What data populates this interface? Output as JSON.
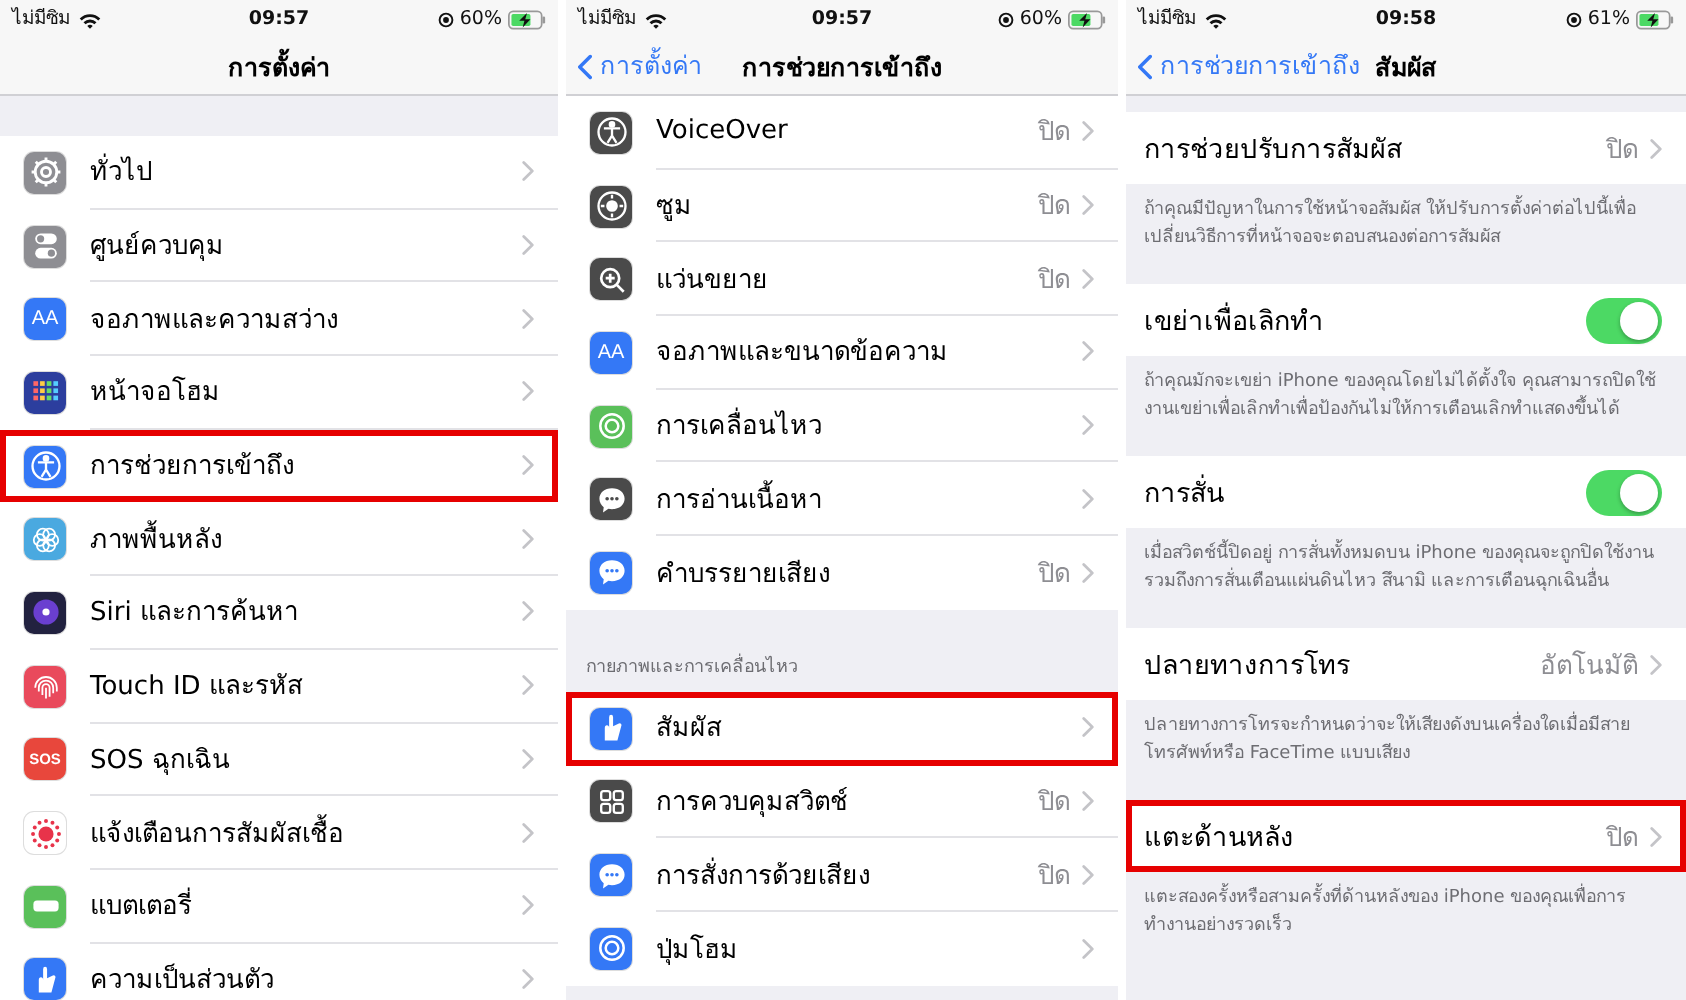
{
  "panels": [
    {
      "kind": "root",
      "status_bar": {
        "carrier": "ไม่มีซิม",
        "time": "09:57",
        "battery": "60%"
      },
      "nav": {
        "title": "การตั้งค่า"
      },
      "groups": [
        {
          "rows": [
            {
              "kind": "link",
              "label": "ทั่วไป",
              "icon": {
                "kind": "gear",
                "color": "#8e8e93"
              },
              "highlighted": false
            },
            {
              "kind": "link",
              "label": "ศูนย์ควบคุม",
              "icon": {
                "kind": "toggles",
                "color": "#8e8e93"
              },
              "highlighted": false
            },
            {
              "kind": "link",
              "label": "จอภาพและความสว่าง",
              "icon": {
                "kind": "text",
                "text": "AA",
                "color": "#3478f6"
              },
              "highlighted": false
            },
            {
              "kind": "link",
              "label": "หน้าจอโฮม",
              "icon": {
                "kind": "grid",
                "color": "#2c3e9e"
              },
              "highlighted": false
            },
            {
              "kind": "link",
              "label": "การช่วยการเข้าถึง",
              "icon": {
                "kind": "person",
                "color": "#3478f6"
              },
              "highlighted": true
            },
            {
              "kind": "link",
              "label": "ภาพพื้นหลัง",
              "icon": {
                "kind": "flower",
                "color": "#4aa9e0"
              },
              "highlighted": false
            },
            {
              "kind": "link",
              "label": "Siri และการค้นหา",
              "icon": {
                "kind": "orb",
                "color": "#222240"
              },
              "highlighted": false
            },
            {
              "kind": "link",
              "label": "Touch ID และรหัส",
              "icon": {
                "kind": "fingerprint",
                "color": "#e94a5c"
              },
              "highlighted": false
            },
            {
              "kind": "link",
              "label": "SOS ฉุกเฉิน",
              "icon": {
                "kind": "text",
                "text": "SOS",
                "color": "#e8473c"
              },
              "highlighted": false
            },
            {
              "kind": "link",
              "label": "แจ้งเตือนการสัมผัสเชื้อ",
              "icon": {
                "kind": "dots",
                "color": "#ffffff"
              },
              "highlighted": false
            },
            {
              "kind": "link",
              "label": "แบตเตอรี่",
              "icon": {
                "kind": "battery",
                "color": "#5ac05a"
              },
              "highlighted": false
            },
            {
              "kind": "link",
              "label": "ความเป็นส่วนตัว",
              "icon": {
                "kind": "hand",
                "color": "#3478f6"
              },
              "highlighted": false
            }
          ]
        }
      ]
    },
    {
      "kind": "list",
      "status_bar": {
        "carrier": "ไม่มีซิม",
        "time": "09:57",
        "battery": "60%"
      },
      "nav": {
        "back": "การตั้งค่า",
        "title": "การช่วยการเข้าถึง"
      },
      "groups": [
        {
          "rows": [
            {
              "kind": "link",
              "label": "VoiceOver",
              "value": "ปิด",
              "icon": {
                "kind": "person",
                "color": "#4a4a4a"
              },
              "highlighted": false
            },
            {
              "kind": "link",
              "label": "ซูม",
              "value": "ปิด",
              "icon": {
                "kind": "target",
                "color": "#4a4a4a"
              },
              "highlighted": false
            },
            {
              "kind": "link",
              "label": "แว่นขยาย",
              "value": "ปิด",
              "icon": {
                "kind": "magnifier",
                "color": "#4a4a4a"
              },
              "highlighted": false
            },
            {
              "kind": "link",
              "label": "จอภาพและขนาดข้อความ",
              "icon": {
                "kind": "text",
                "text": "AA",
                "color": "#3478f6"
              },
              "highlighted": false
            },
            {
              "kind": "link",
              "label": "การเคลื่อนไหว",
              "icon": {
                "kind": "circle",
                "color": "#5ac05a"
              },
              "highlighted": false
            },
            {
              "kind": "link",
              "label": "การอ่านเนื้อหา",
              "icon": {
                "kind": "bubble",
                "color": "#4a4a4a"
              },
              "highlighted": false
            },
            {
              "kind": "link",
              "label": "คำบรรยายเสียง",
              "value": "ปิด",
              "icon": {
                "kind": "bubble",
                "color": "#3478f6"
              },
              "highlighted": false
            }
          ]
        },
        {
          "header": "กายภาพและการเคลื่อนไหว",
          "rows": [
            {
              "kind": "link",
              "label": "สัมผัส",
              "icon": {
                "kind": "hand",
                "color": "#3478f6"
              },
              "highlighted": true
            },
            {
              "kind": "link",
              "label": "การควบคุมสวิตช์",
              "value": "ปิด",
              "icon": {
                "kind": "grid4",
                "color": "#4a4a4a"
              },
              "highlighted": false
            },
            {
              "kind": "link",
              "label": "การสั่งการด้วยเสียง",
              "value": "ปิด",
              "icon": {
                "kind": "bubble",
                "color": "#3478f6"
              },
              "highlighted": false
            },
            {
              "kind": "link",
              "label": "ปุ่มโฮม",
              "icon": {
                "kind": "circle",
                "color": "#3478f6"
              },
              "highlighted": false
            }
          ]
        }
      ]
    },
    {
      "kind": "detail",
      "status_bar": {
        "carrier": "ไม่มีซิม",
        "time": "09:58",
        "battery": "61%"
      },
      "nav": {
        "back": "การช่วยการเข้าถึง",
        "title": "สัมผัส"
      },
      "groups": [
        {
          "rows": [
            {
              "kind": "link",
              "label": "การช่วยปรับการสัมผัส",
              "value": "ปิด",
              "highlighted": false
            }
          ],
          "footer": "ถ้าคุณมีปัญหาในการใช้หน้าจอสัมผัส ให้ปรับการตั้งค่าต่อไปนี้เพื่อเปลี่ยนวิธีการที่หน้าจอจะตอบสนองต่อการสัมผัส"
        },
        {
          "rows": [
            {
              "kind": "toggle",
              "label": "เขย่าเพื่อเลิกทำ",
              "on": true,
              "highlighted": false
            }
          ],
          "footer": "ถ้าคุณมักจะเขย่า iPhone ของคุณโดยไม่ได้ตั้งใจ คุณสามารถปิดใช้งานเขย่าเพื่อเลิกทำเพื่อป้องกันไม่ให้การเตือนเลิกทำแสดงขึ้นได้"
        },
        {
          "rows": [
            {
              "kind": "toggle",
              "label": "การสั่น",
              "on": true,
              "highlighted": false
            }
          ],
          "footer": "เมื่อสวิตช์นี้ปิดอยู่ การสั่นทั้งหมดบน iPhone ของคุณจะถูกปิดใช้งานรวมถึงการสั่นเตือนแผ่นดินไหว สึนามิ และการเตือนฉุกเฉินอื่น"
        },
        {
          "rows": [
            {
              "kind": "link",
              "label": "ปลายทางการโทร",
              "value": "อัตโนมัติ",
              "highlighted": false
            }
          ],
          "footer": "ปลายทางการโทรจะกำหนดว่าจะให้เสียงดังบนเครื่องใดเมื่อมีสายโทรศัพท์หรือ FaceTime แบบเสียง"
        },
        {
          "rows": [
            {
              "kind": "link",
              "label": "แตะด้านหลัง",
              "value": "ปิด",
              "highlighted": true
            }
          ],
          "footer": "แตะสองครั้งหรือสามครั้งที่ด้านหลังของ iPhone ของคุณเพื่อการทำงานอย่างรวดเร็ว"
        }
      ]
    }
  ]
}
